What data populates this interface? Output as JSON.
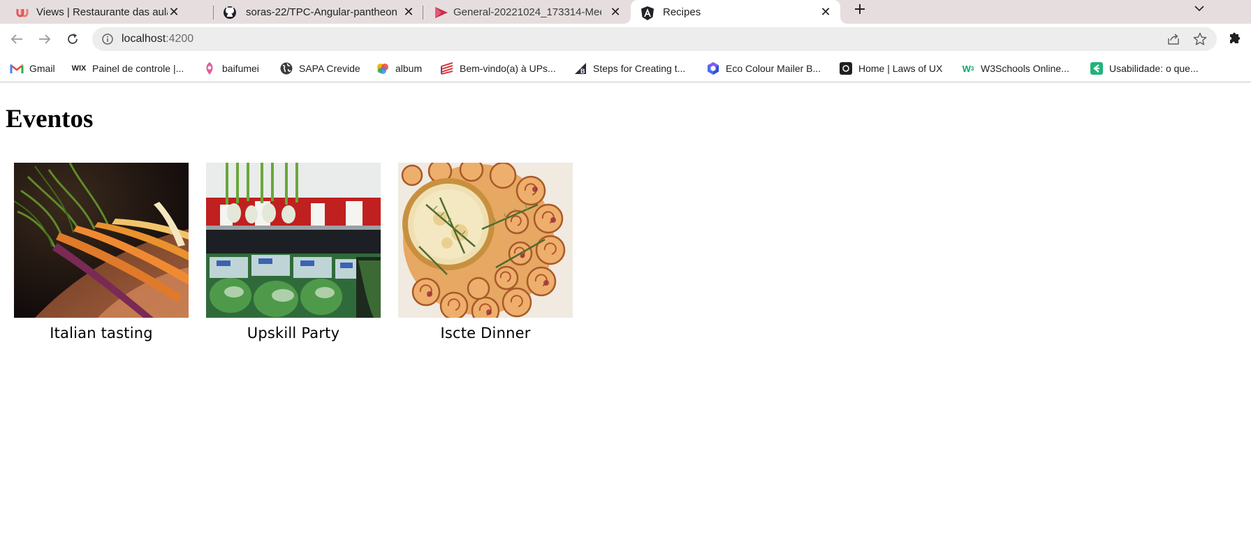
{
  "browser": {
    "tabs": [
      {
        "title": "Views | Restaurante das aulas",
        "icon": "udemy-icon",
        "active": false
      },
      {
        "title": "soras-22/TPC-Angular-pantheon",
        "icon": "github-icon",
        "active": false
      },
      {
        "title": "General-20221024_173314-Meeti",
        "icon": "stream-video-icon",
        "active": false
      },
      {
        "title": "Recipes",
        "icon": "angular-icon",
        "active": true
      }
    ],
    "address": {
      "host": "localhost",
      "port": ":4200"
    },
    "bookmarks": [
      {
        "label": "Gmail",
        "icon": "gmail-icon"
      },
      {
        "label": "Painel de controle |...",
        "icon": "wix-icon"
      },
      {
        "label": "baifumei",
        "icon": "baifumei-icon"
      },
      {
        "label": "SAPA Crevide",
        "icon": "globe-icon"
      },
      {
        "label": "album",
        "icon": "album-icon"
      },
      {
        "label": "Bem-vindo(a) à UPs...",
        "icon": "upskill-icon"
      },
      {
        "label": "Steps for Creating t...",
        "icon": "bigcommerce-icon"
      },
      {
        "label": "Eco Colour Mailer B...",
        "icon": "eco-cube-icon"
      },
      {
        "label": "Home | Laws of UX",
        "icon": "lawsofux-icon"
      },
      {
        "label": "W3Schools Online...",
        "icon": "w3schools-icon"
      },
      {
        "label": "Usabilidade: o que...",
        "icon": "usabilidade-icon"
      }
    ]
  },
  "page": {
    "title": "Eventos",
    "events": [
      {
        "name": "Italian tasting",
        "image": "carrots-photo"
      },
      {
        "name": "Upskill Party",
        "image": "greens-fridge-photo"
      },
      {
        "name": "Iscte Dinner",
        "image": "pastry-wheel-photo"
      }
    ]
  },
  "colors": {
    "tabstrip": "#e6dede",
    "omnibox": "#ededed",
    "accent_udemy": "#ea5252",
    "accent_stream": "#c4314b"
  }
}
